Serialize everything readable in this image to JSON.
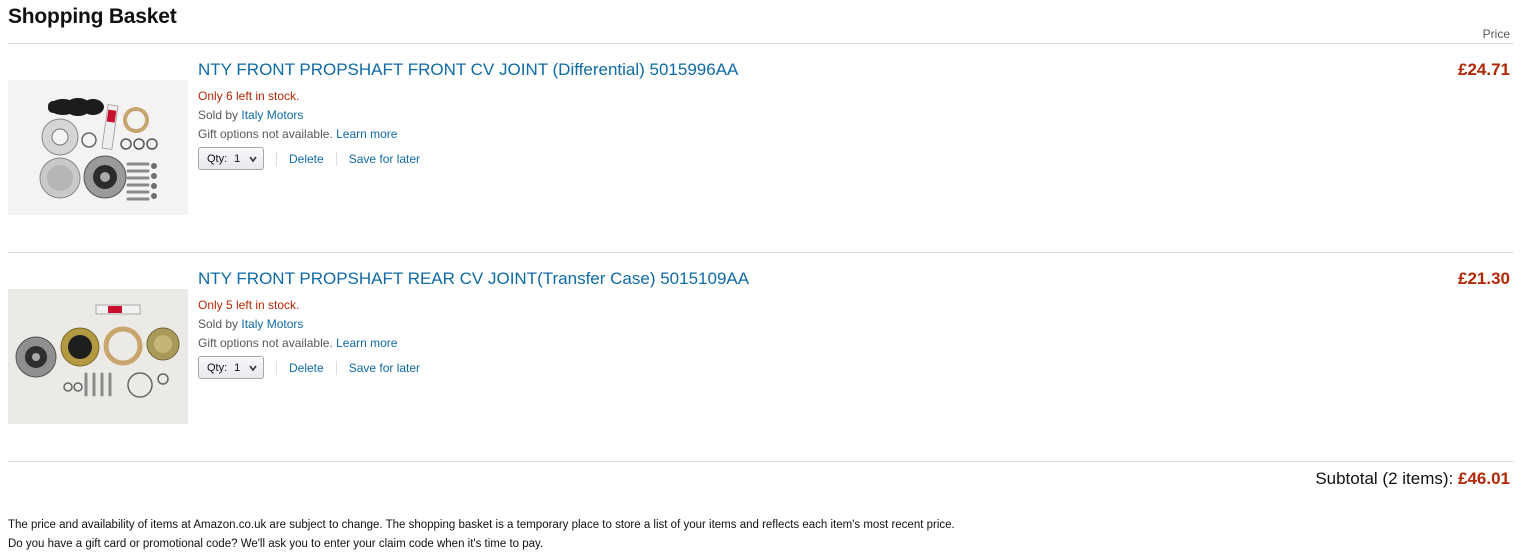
{
  "page": {
    "title": "Shopping Basket",
    "price_header": "Price"
  },
  "items": [
    {
      "title": "NTY FRONT PROPSHAFT FRONT CV JOINT (Differential) 5015996AA",
      "stock": "Only 6 left in stock.",
      "sold_by_label": "Sold by",
      "seller": "Italy Motors",
      "gift_text": "Gift options not available.",
      "learn_more": "Learn more",
      "qty_label": "Qty:",
      "qty_value": "1",
      "delete_label": "Delete",
      "save_label": "Save for later",
      "price": "£24.71",
      "image_icon": "cv-joint-kit-image"
    },
    {
      "title": "NTY FRONT PROPSHAFT REAR CV JOINT(Transfer Case) 5015109AA",
      "stock": "Only 5 left in stock.",
      "sold_by_label": "Sold by",
      "seller": "Italy Motors",
      "gift_text": "Gift options not available.",
      "learn_more": "Learn more",
      "qty_label": "Qty:",
      "qty_value": "1",
      "delete_label": "Delete",
      "save_label": "Save for later",
      "price": "£21.30",
      "image_icon": "cv-joint-kit-image"
    }
  ],
  "subtotal": {
    "label": "Subtotal (2 items):",
    "amount": "£46.01"
  },
  "footer": {
    "line1": "The price and availability of items at Amazon.co.uk are subject to change. The shopping basket is a temporary place to store a list of your items and reflects each item's most recent price.",
    "line2": "Do you have a gift card or promotional code? We'll ask you to enter your claim code when it's time to pay."
  },
  "colors": {
    "link": "#0f6aa6",
    "price": "#b12704",
    "stock": "#b12704",
    "divider": "#dddddd"
  }
}
